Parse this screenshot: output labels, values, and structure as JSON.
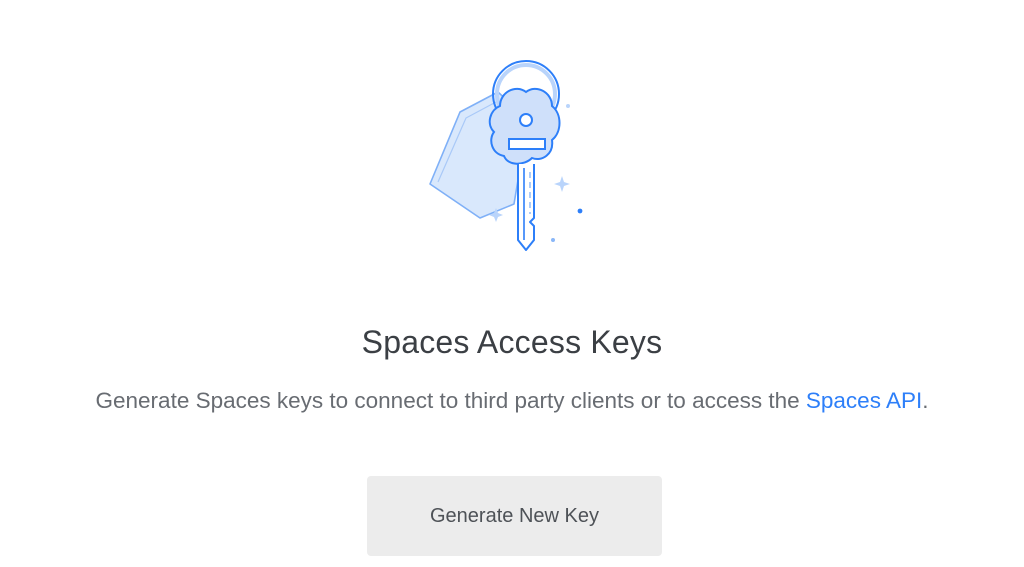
{
  "illustration": {
    "icon": "key-with-tag-illustration",
    "colors": {
      "line": "#2d7ff9",
      "fill_light": "#d6e6fc",
      "fill_tag": "#cfe0fa"
    }
  },
  "empty_state": {
    "title": "Spaces Access Keys",
    "description_prefix": "Generate Spaces keys to connect to third party clients or to access the ",
    "description_link": "Spaces API",
    "description_suffix": ".",
    "button_label": "Generate New Key"
  },
  "colors": {
    "accent": "#2d7ff9",
    "title": "#3b3f44",
    "body_text": "#686c72",
    "button_bg": "#ececec"
  }
}
